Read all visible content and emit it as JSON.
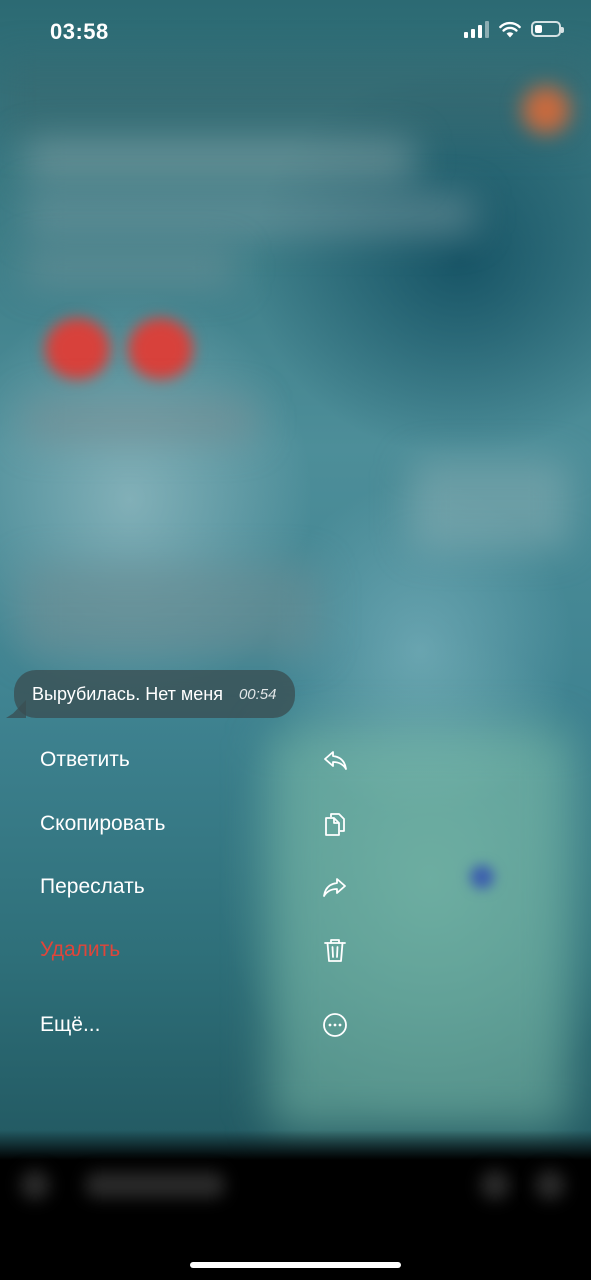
{
  "status_bar": {
    "time": "03:58",
    "battery_level": 0.3
  },
  "message": {
    "text": "Вырубилась. Нет меня",
    "time": "00:54"
  },
  "menu": {
    "items": [
      {
        "label": "Ответить",
        "icon": "reply-icon"
      },
      {
        "label": "Скопировать",
        "icon": "copy-icon"
      },
      {
        "label": "Переслать",
        "icon": "forward-icon"
      },
      {
        "label": "Удалить",
        "icon": "trash-icon",
        "color": "#e0453a"
      },
      {
        "label": "Ещё...",
        "icon": "more-icon"
      }
    ]
  },
  "colors": {
    "danger": "#e0453a",
    "bubble": "#3a4e52"
  }
}
